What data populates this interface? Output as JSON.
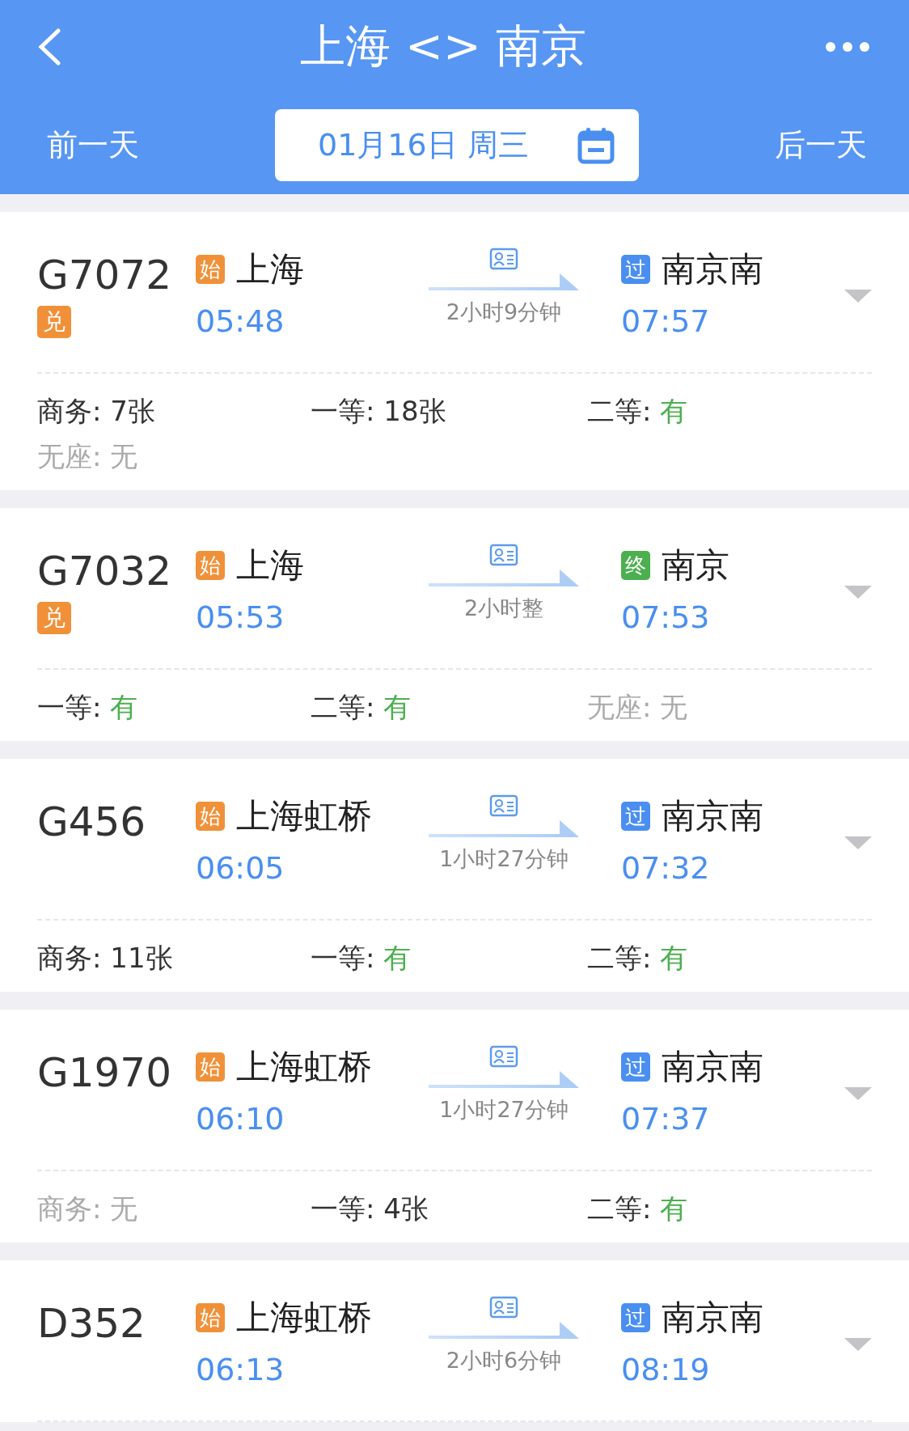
{
  "header": {
    "title": "上海 <> 南京",
    "prev_day": "前一天",
    "date": "01月16日 周三",
    "next_day": "后一天"
  },
  "trains": [
    {
      "number": "G7072",
      "badge": "兑",
      "from": {
        "tag": "始",
        "color": "#f0913a",
        "station": "上海",
        "time": "05:48"
      },
      "duration": "2小时9分钟",
      "to": {
        "tag": "过",
        "color": "#4a8ff0",
        "station": "南京南",
        "time": "07:57"
      },
      "seats": [
        {
          "label": "商务:",
          "value": "7张",
          "kind": "count"
        },
        {
          "label": "一等:",
          "value": "18张",
          "kind": "count"
        },
        {
          "label": "二等:",
          "value": "有",
          "kind": "plenty"
        },
        {
          "label": "无座:",
          "value": "无",
          "kind": "none"
        }
      ]
    },
    {
      "number": "G7032",
      "badge": "兑",
      "from": {
        "tag": "始",
        "color": "#f0913a",
        "station": "上海",
        "time": "05:53"
      },
      "duration": "2小时整",
      "to": {
        "tag": "终",
        "color": "#4caf50",
        "station": "南京",
        "time": "07:53"
      },
      "seats": [
        {
          "label": "一等:",
          "value": "有",
          "kind": "plenty"
        },
        {
          "label": "二等:",
          "value": "有",
          "kind": "plenty"
        },
        {
          "label": "无座:",
          "value": "无",
          "kind": "none"
        }
      ]
    },
    {
      "number": "G456",
      "from": {
        "tag": "始",
        "color": "#f0913a",
        "station": "上海虹桥",
        "time": "06:05"
      },
      "duration": "1小时27分钟",
      "to": {
        "tag": "过",
        "color": "#4a8ff0",
        "station": "南京南",
        "time": "07:32"
      },
      "seats": [
        {
          "label": "商务:",
          "value": "11张",
          "kind": "count"
        },
        {
          "label": "一等:",
          "value": "有",
          "kind": "plenty"
        },
        {
          "label": "二等:",
          "value": "有",
          "kind": "plenty"
        }
      ]
    },
    {
      "number": "G1970",
      "from": {
        "tag": "始",
        "color": "#f0913a",
        "station": "上海虹桥",
        "time": "06:10"
      },
      "duration": "1小时27分钟",
      "to": {
        "tag": "过",
        "color": "#4a8ff0",
        "station": "南京南",
        "time": "07:37"
      },
      "seats": [
        {
          "label": "商务:",
          "value": "无",
          "kind": "none"
        },
        {
          "label": "一等:",
          "value": "4张",
          "kind": "count"
        },
        {
          "label": "二等:",
          "value": "有",
          "kind": "plenty"
        }
      ]
    },
    {
      "number": "D352",
      "from": {
        "tag": "始",
        "color": "#f0913a",
        "station": "上海虹桥",
        "time": "06:13"
      },
      "duration": "2小时6分钟",
      "to": {
        "tag": "过",
        "color": "#4a8ff0",
        "station": "南京南",
        "time": "08:19"
      }
    }
  ]
}
